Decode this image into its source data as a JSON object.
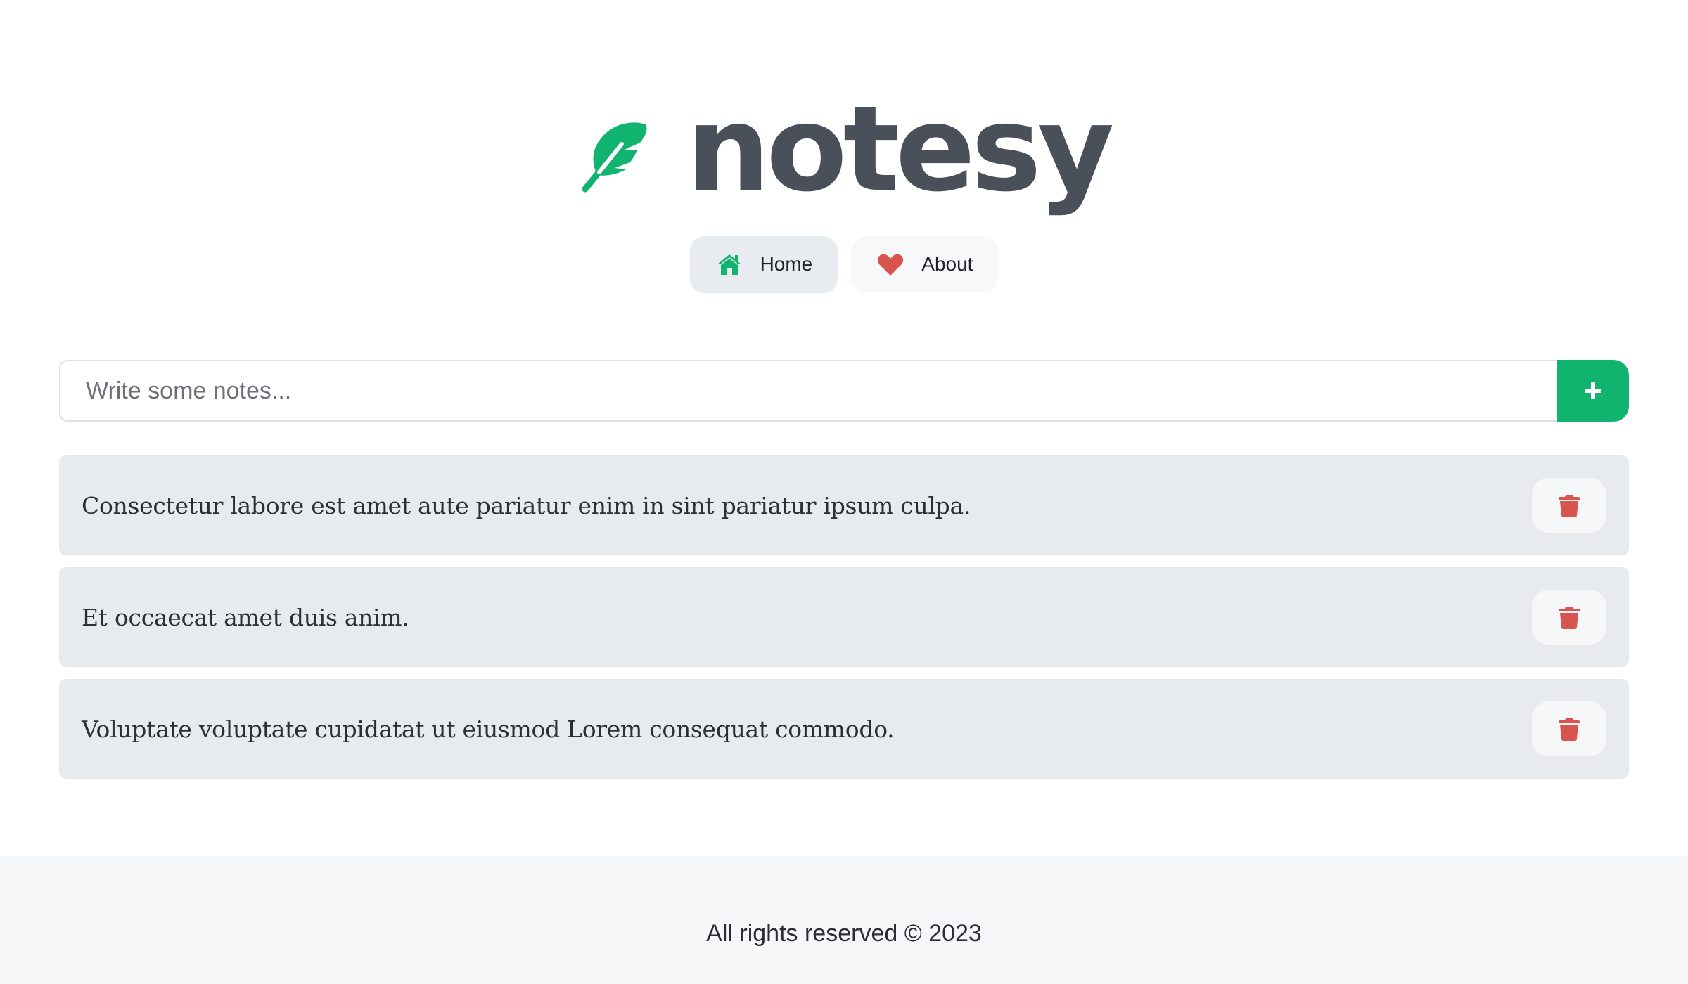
{
  "brand": {
    "name": "notesy",
    "icon": "feather-icon",
    "accent_color": "#10b46f"
  },
  "nav": {
    "items": [
      {
        "label": "Home",
        "icon": "home-icon",
        "active": true
      },
      {
        "label": "About",
        "icon": "heart-icon",
        "active": false
      }
    ]
  },
  "composer": {
    "placeholder": "Write some notes...",
    "value": "",
    "add_icon": "plus-icon"
  },
  "notes": [
    {
      "text": "Consectetur labore est amet aute pariatur enim in sint pariatur ipsum culpa.",
      "delete_icon": "trash-icon"
    },
    {
      "text": "Et occaecat amet duis anim.",
      "delete_icon": "trash-icon"
    },
    {
      "text": "Voluptate voluptate cupidatat ut eiusmod Lorem consequat commodo.",
      "delete_icon": "trash-icon"
    }
  ],
  "colors": {
    "accent": "#10b46f",
    "danger": "#d9534f",
    "text_dark": "#4a5059"
  },
  "footer": {
    "text": "All rights reserved © 2023"
  }
}
